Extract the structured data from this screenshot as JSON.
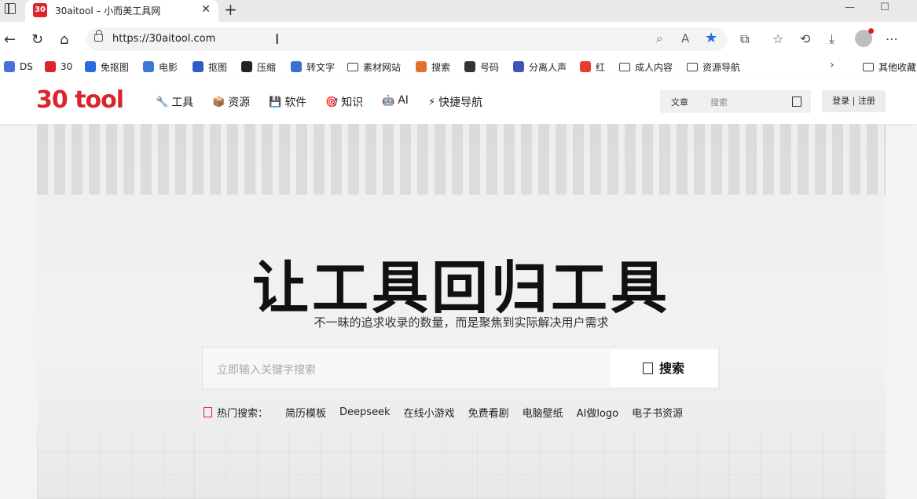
{
  "browser": {
    "tab_title": "30aitool – 小而美工具网",
    "tab_favicon": "30",
    "url": "https://30aitool.com"
  },
  "bookmarks": [
    {
      "label": "DS",
      "icon": "ds-icon",
      "color": "#4a6fd6"
    },
    {
      "label": "30",
      "icon": "30-icon",
      "color": "#d9252b"
    },
    {
      "label": "免抠图",
      "icon": "p-icon",
      "color": "#2a6adf"
    },
    {
      "label": "电影",
      "icon": "film-icon",
      "color": "#3a7bd5"
    },
    {
      "label": "抠图",
      "icon": "cutout-icon",
      "color": "#2f5ac8"
    },
    {
      "label": "压缩",
      "icon": "compress-icon",
      "color": "#222222"
    },
    {
      "label": "转文字",
      "icon": "convert-icon",
      "color": "#3b6fd0"
    },
    {
      "label": "素材网站",
      "icon": "folder-icon",
      "color": "#444444"
    },
    {
      "label": "搜索",
      "icon": "search-s-icon",
      "color": "#e0702a"
    },
    {
      "label": "号码",
      "icon": "phone-icon",
      "color": "#333333"
    },
    {
      "label": "分离人声",
      "icon": "v-icon",
      "color": "#4054b2"
    },
    {
      "label": "红",
      "icon": "red-icon",
      "color": "#e83a2e"
    },
    {
      "label": "成人内容",
      "icon": "folder-icon",
      "color": "#444444"
    },
    {
      "label": "资源导航",
      "icon": "folder-icon",
      "color": "#444444"
    }
  ],
  "bookmarks_other": "其他收藏",
  "site": {
    "logo": "30 tool",
    "nav": [
      {
        "label": "工具",
        "icon": "wrench-icon",
        "glyph": "🔧"
      },
      {
        "label": "资源",
        "icon": "box-icon",
        "glyph": "📦"
      },
      {
        "label": "软件",
        "icon": "floppy-icon",
        "glyph": "💾"
      },
      {
        "label": "知识",
        "icon": "target-icon",
        "glyph": "🎯"
      },
      {
        "label": "AI",
        "icon": "robot-icon",
        "glyph": "🤖"
      },
      {
        "label": "快捷导航",
        "icon": "bolt-icon",
        "glyph": "⚡"
      }
    ],
    "search_category": "文章",
    "search_placeholder": "搜索",
    "login": "登录 | 注册"
  },
  "hero": {
    "title": "让工具回归工具",
    "subtitle": "不一昧的追求收录的数量，而是聚焦到实际解决用户需求",
    "search_placeholder": "立即输入关键字搜索",
    "search_button": "搜索",
    "hot_label": "热门搜索：",
    "hot_keywords": [
      "简历模板",
      "Deepseek",
      "在线小游戏",
      "免费看剧",
      "电脑壁纸",
      "AI做logo",
      "电子书资源"
    ]
  }
}
